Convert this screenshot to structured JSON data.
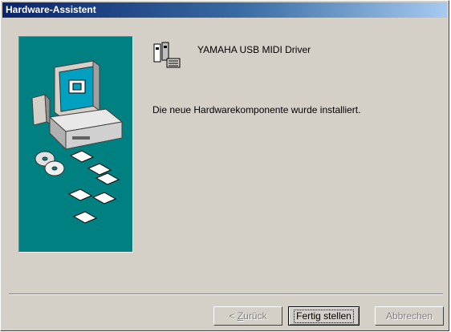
{
  "window": {
    "title": "Hardware-Assistent"
  },
  "device": {
    "name": "YAMAHA USB MIDI Driver",
    "icon": "midi-device-icon"
  },
  "status": {
    "message": "Die neue Hardwarekomponente wurde installiert."
  },
  "buttons": {
    "back": {
      "prefix": "< ",
      "mnemonic": "Z",
      "rest": "urück",
      "enabled": false
    },
    "finish": {
      "label": "Fertig stellen",
      "enabled": true,
      "default": true
    },
    "cancel": {
      "label": "Abbrechen",
      "enabled": false
    }
  },
  "colors": {
    "title_start": "#0a246a",
    "title_end": "#a6caf0",
    "panel": "#008080",
    "dialog": "#d4d0c8"
  }
}
